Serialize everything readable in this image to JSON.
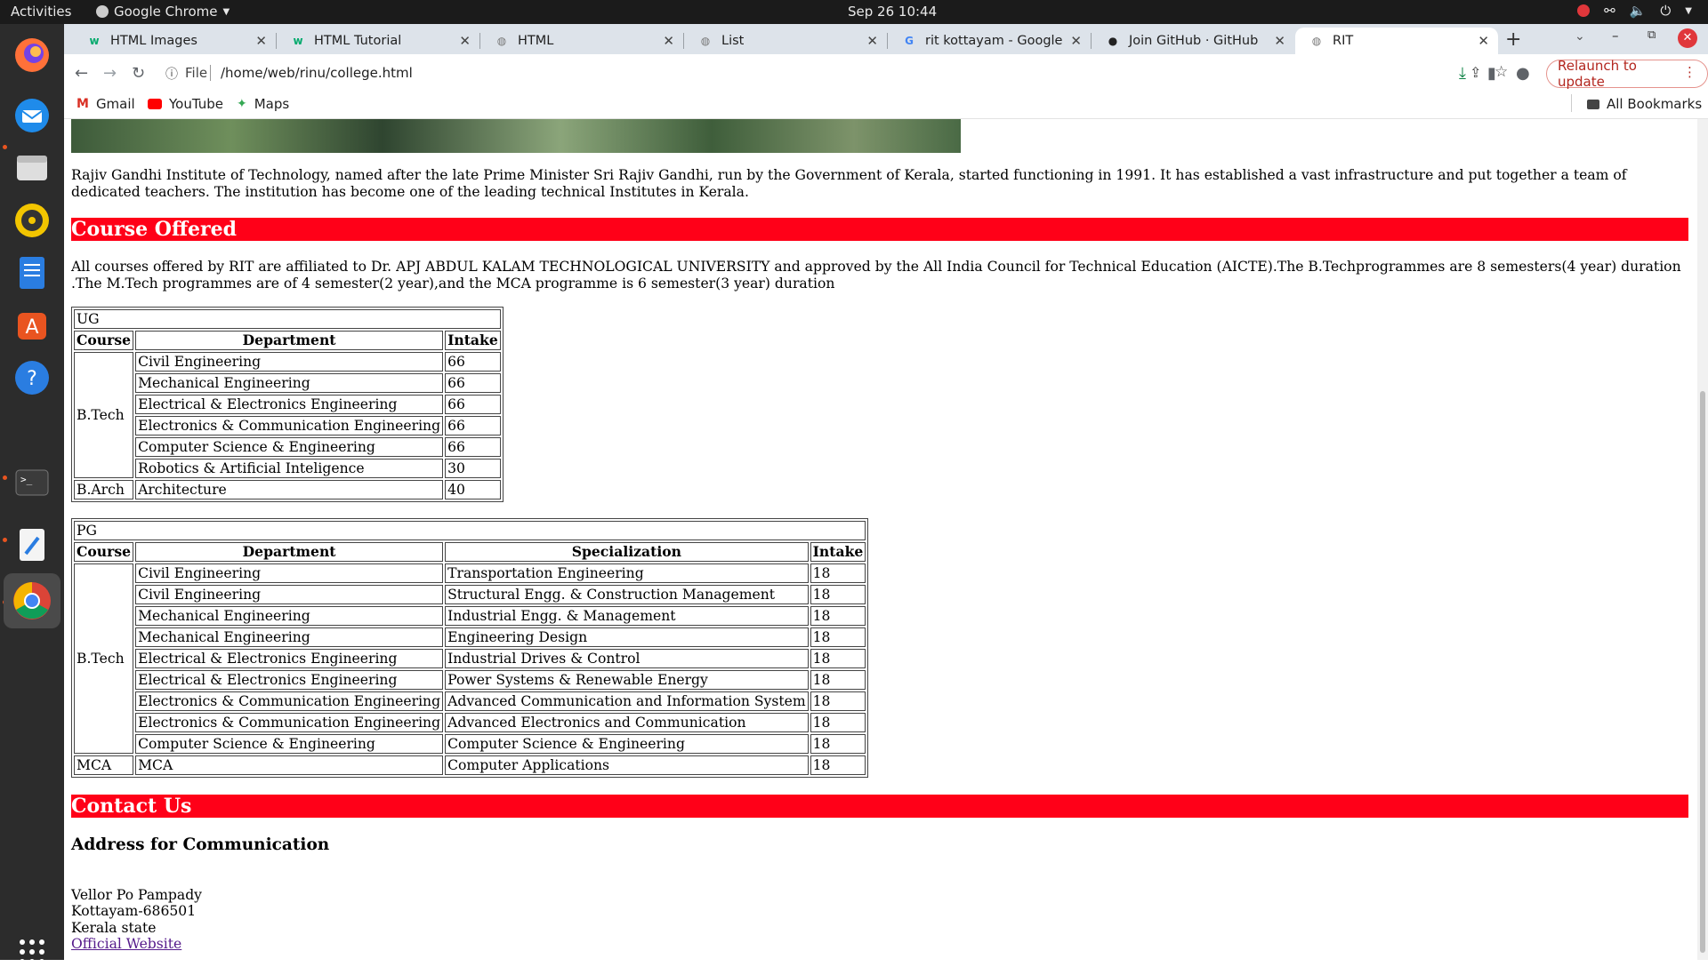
{
  "system": {
    "activities": "Activities",
    "app_name": "Google Chrome",
    "clock": "Sep 26  10:44"
  },
  "browser": {
    "tabs": [
      {
        "title": "HTML Images",
        "favicon": "w3schools-icon",
        "active": false
      },
      {
        "title": "HTML Tutorial",
        "favicon": "w3schools-icon",
        "active": false
      },
      {
        "title": "HTML",
        "favicon": "globe-icon",
        "active": false
      },
      {
        "title": "List",
        "favicon": "globe-icon",
        "active": false
      },
      {
        "title": "rit kottayam - Google Se",
        "favicon": "google-icon",
        "active": false
      },
      {
        "title": "Join GitHub · GitHub",
        "favicon": "github-icon",
        "active": false
      },
      {
        "title": "RIT",
        "favicon": "globe-icon",
        "active": true
      }
    ],
    "address": {
      "scheme_label": "File",
      "url": "/home/web/rinu/college.html"
    },
    "relaunch_label": "Relaunch to update",
    "bookmarks": [
      "Gmail",
      "YouTube",
      "Maps"
    ],
    "all_bookmarks_label": "All Bookmarks"
  },
  "page": {
    "intro": "Rajiv Gandhi Institute of Technology, named after the late Prime Minister Sri Rajiv Gandhi, run by the Government of Kerala, started functioning in 1991. It has established a vast infrastructure and put together a team of dedicated teachers. The institution has become one of the leading technical Institutes in Kerala.",
    "courses_heading": "Course Offered",
    "courses_text": "All courses offered by RIT are affiliated to Dr. APJ ABDUL KALAM TECHNOLOGICAL UNIVERSITY and approved by the All India Council for Technical Education (AICTE).The B.Techprogrammes are 8 semesters(4 year) duration .The M.Tech programmes are of 4 semester(2 year),and the MCA programme is 6 semester(3 year) duration",
    "ug": {
      "caption": "UG",
      "headers": [
        "Course",
        "Department",
        "Intake"
      ],
      "btech_label": "B.Tech",
      "btech_rows": [
        [
          "Civil Engineering",
          "66"
        ],
        [
          "Mechanical Engineering",
          "66"
        ],
        [
          "Electrical & Electronics Engineering",
          "66"
        ],
        [
          "Electronics & Communication Engineering",
          "66"
        ],
        [
          "Computer Science & Engineering",
          "66"
        ],
        [
          "Robotics & Artificial Inteligence",
          "30"
        ]
      ],
      "barch_row": [
        "B.Arch",
        "Architecture",
        "40"
      ]
    },
    "pg": {
      "caption": "PG",
      "headers": [
        "Course",
        "Department",
        "Specialization",
        "Intake"
      ],
      "btech_label": "B.Tech",
      "btech_rows": [
        [
          "Civil Engineering",
          "Transportation Engineering",
          "18"
        ],
        [
          "Civil Engineering",
          "Structural Engg. & Construction Management",
          "18"
        ],
        [
          "Mechanical Engineering",
          "Industrial Engg. & Management",
          "18"
        ],
        [
          "Mechanical Engineering",
          "Engineering Design",
          "18"
        ],
        [
          "Electrical & Electronics Engineering",
          "Industrial Drives & Control",
          "18"
        ],
        [
          "Electrical & Electronics Engineering",
          "Power Systems & Renewable Energy",
          "18"
        ],
        [
          "Electronics & Communication Engineering",
          "Advanced Communication and Information System",
          "18"
        ],
        [
          "Electronics & Communication Engineering",
          "Advanced Electronics and Communication",
          "18"
        ],
        [
          "Computer Science & Engineering",
          "Computer Science & Engineering",
          "18"
        ]
      ],
      "mca_row": [
        "MCA",
        "MCA",
        "Computer Applications",
        "18"
      ]
    },
    "contact_heading": "Contact Us",
    "address_heading": "Address for Communication",
    "address_lines": [
      "Vellor Po Pampady",
      "Kottayam-686501",
      "Kerala state"
    ],
    "website_link": "Official Website"
  }
}
